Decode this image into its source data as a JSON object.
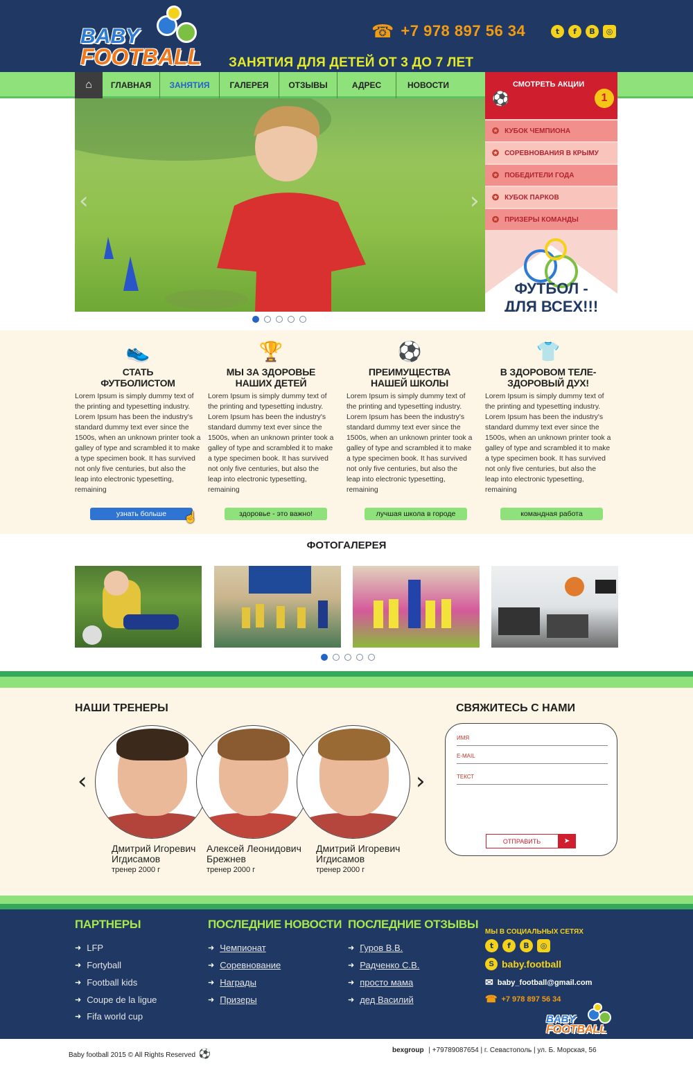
{
  "header": {
    "logo_line1": "BABY",
    "logo_line2": "FOOTBALL",
    "phone": "+7 978 897 56 34",
    "tagline": "ЗАНЯТИЯ ДЛЯ ДЕТЕЙ ОТ 3 ДО 7 ЛЕТ",
    "social": [
      "twitter-icon",
      "facebook-icon",
      "vk-icon",
      "instagram-icon"
    ]
  },
  "nav": {
    "home_icon": "home-icon",
    "items": [
      {
        "label": "ГЛАВНАЯ",
        "active": false
      },
      {
        "label": "ЗАНЯТИЯ",
        "active": true
      },
      {
        "label": "ГАЛЕРЕЯ",
        "active": false
      },
      {
        "label": "ОТЗЫВЫ",
        "active": false
      },
      {
        "label": "АДРЕС",
        "active": false
      },
      {
        "label": "НОВОСТИ",
        "active": false
      }
    ]
  },
  "promo": {
    "title": "СМОТРЕТЬ АКЦИИ",
    "badge": "1",
    "items": [
      "КУБОК ЧЕМПИОНА",
      "СОРЕВНОВАНИЯ В КРЫМУ",
      "ПОБЕДИТЕЛИ ГОДА",
      "КУБОК ПАРКОВ",
      "ПРИЗЕРЫ КОМАНДЫ"
    ],
    "tagline": "ФУТБОЛ - ДЛЯ ВСЕХ!!!"
  },
  "slider": {
    "active_dot": 1,
    "dot_count": 5
  },
  "features": [
    {
      "icon": "boot-icon",
      "title_line1": "СТАТЬ",
      "title_line2": "ФУТБОЛИСТОМ",
      "button": "узнать больше",
      "button_style": "blue",
      "text": "Lorem Ipsum is simply dummy text of the printing and typesetting industry. Lorem Ipsum has been the industry's standard dummy text ever since the 1500s, when an unknown printer took a galley of type and scrambled it to make a type specimen book. It has survived not only five centuries, but also the leap into electronic typesetting, remaining"
    },
    {
      "icon": "trophy-icon",
      "title_line1": "МЫ ЗА ЗДОРОВЬЕ",
      "title_line2": "НАШИХ ДЕТЕЙ",
      "button": "здоровье - это важно!",
      "button_style": "green",
      "text": "Lorem Ipsum is simply dummy text of the printing and typesetting industry. Lorem Ipsum has been the industry's standard dummy text ever since the 1500s, when an unknown printer took a galley of type and scrambled it to make a type specimen book. It has survived not only five centuries, but also the leap into electronic typesetting, remaining"
    },
    {
      "icon": "soccer-ball-icon",
      "title_line1": "ПРЕИМУЩЕСТВА",
      "title_line2": "НАШЕЙ ШКОЛЫ",
      "button": "лучшая школа в городе",
      "button_style": "green",
      "text": "Lorem Ipsum is simply dummy text of the printing and typesetting industry. Lorem Ipsum has been the industry's standard dummy text ever since the 1500s, when an unknown printer took a galley of type and scrambled it to make a type specimen book. It has survived not only five centuries, but also the leap into electronic typesetting, remaining"
    },
    {
      "icon": "jersey-icon",
      "title_line1": "В ЗДОРОВОМ ТЕЛЕ-",
      "title_line2": "ЗДОРОВЫЙ ДУХ!",
      "button": "командная работа",
      "button_style": "green",
      "text": "Lorem Ipsum is simply dummy text of the printing and typesetting industry. Lorem Ipsum has been the industry's standard dummy text ever since the 1500s, when an unknown printer took a galley of type and scrambled it to make a type specimen book. It has survived not only five centuries, but also the leap into electronic typesetting, remaining"
    }
  ],
  "gallery": {
    "title": "ФОТОГАЛЕРЕЯ",
    "active_dot": 1,
    "dot_count": 5
  },
  "trainers": {
    "title": "НАШИ ТРЕНЕРЫ",
    "people": [
      {
        "name_line1": "Дмитрий Игоревич",
        "name_line2": "Игдисамов",
        "role": "тренер 2000 г"
      },
      {
        "name_line1": "Алексей Леонидович",
        "name_line2": "Брежнев",
        "role": "тренер 2000 г"
      },
      {
        "name_line1": "Дмитрий Игоревич",
        "name_line2": "Игдисамов",
        "role": "тренер 2000 г"
      }
    ]
  },
  "contact": {
    "title": "СВЯЖИТЕСЬ С НАМИ",
    "name_placeholder": "ИМЯ",
    "email_placeholder": "E-MAIL",
    "text_placeholder": "ТЕКСТ",
    "submit": "ОТПРАВИТЬ"
  },
  "footer": {
    "partners_title": "ПАРТНЕРЫ",
    "partners": [
      "LFP",
      "Fortyball",
      "Football kids",
      "Coupe de la ligue",
      "Fifa world cup"
    ],
    "news_title": "ПОСЛЕДНИЕ НОВОСТИ",
    "news": [
      "Чемпионат",
      "Соревнование",
      "Награды",
      "Призеры"
    ],
    "reviews_title": "ПОСЛЕДНИЕ ОТЗЫВЫ",
    "reviews": [
      "Гуров В.В.",
      "Радченко С.В.",
      "просто мама",
      "дед Василий"
    ],
    "social_title": "МЫ В СОЦИАЛЬНЫХ СЕТЯХ",
    "skype": "baby.football",
    "email": "baby_football@gmail.com",
    "phone": "+7 978 897 56 34",
    "logo_line1": "BABY",
    "logo_line2": "FOOTBALL"
  },
  "bottom": {
    "copyright": "Baby football 2015 © All Rights Reserved",
    "company": "bexgroup",
    "details": "| +79789087654 | г. Севастополь | ул. Б. Морская, 56"
  },
  "colors": {
    "navy": "#1f3864",
    "green": "#8fe17c",
    "red": "#cf1f2f",
    "yellow": "#e3ea2b",
    "orange": "#f39c12"
  }
}
